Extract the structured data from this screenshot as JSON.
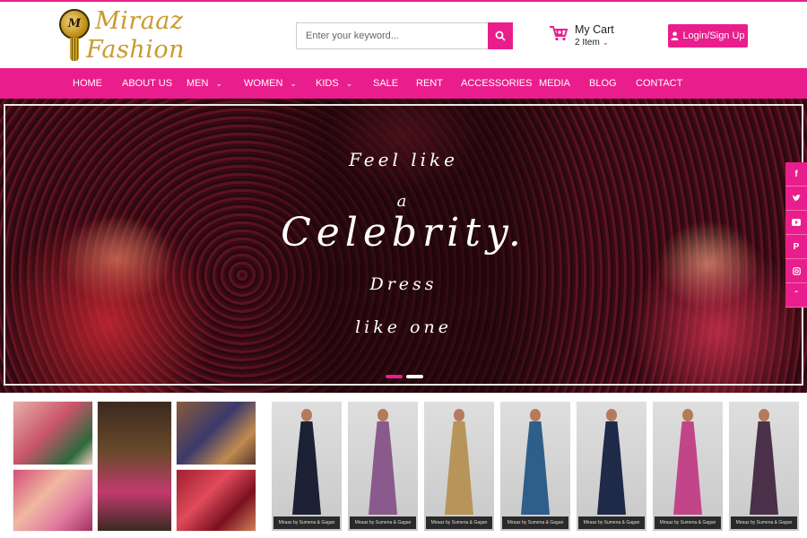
{
  "brand": {
    "logo_monogram": "M",
    "logo_line1": "Miraaz",
    "logo_line2": "Fashion"
  },
  "search": {
    "placeholder": "Enter your keyword..."
  },
  "cart": {
    "title": "My Cart",
    "count": "2 Item"
  },
  "login": {
    "label": "Login/Sign Up"
  },
  "nav": {
    "items": [
      {
        "label": "HOME"
      },
      {
        "label": "ABOUT US"
      },
      {
        "label": "MEN"
      },
      {
        "label": "WOMEN"
      },
      {
        "label": "KIDS"
      },
      {
        "label": "SALE"
      },
      {
        "label": "RENT"
      },
      {
        "label": "ACCESSORIES"
      },
      {
        "label": "MEDIA"
      },
      {
        "label": "BLOG"
      },
      {
        "label": "CONTACT"
      }
    ]
  },
  "hero": {
    "line1": "Feel like",
    "line2": "a",
    "line3": "Celebrity.",
    "line4": "Dress",
    "line5": "like one",
    "slides": 2,
    "active_slide": 1
  },
  "social": [
    "facebook-icon",
    "twitter-icon",
    "youtube-icon",
    "pinterest-icon",
    "instagram-icon",
    "scroll-top-icon"
  ],
  "products": [
    {
      "label": "Miraaz by Sumena & Gagan",
      "color": "#1c2136"
    },
    {
      "label": "Miraaz by Sumena & Gagan",
      "color": "#8a5a8c"
    },
    {
      "label": "Miraaz by Sumena & Gagan",
      "color": "#b7955a"
    },
    {
      "label": "Miraaz by Sumena & Gagan",
      "color": "#2e5f8a"
    },
    {
      "label": "Miraaz by Sumena & Gagan",
      "color": "#1f2a4a"
    },
    {
      "label": "Miraaz by Sumena & Gagan",
      "color": "#c2458a"
    },
    {
      "label": "Miraaz by Sumena & Gagan",
      "color": "#4a3048"
    }
  ],
  "colors": {
    "accent": "#e91e8c",
    "gold": "#c99a2e"
  }
}
